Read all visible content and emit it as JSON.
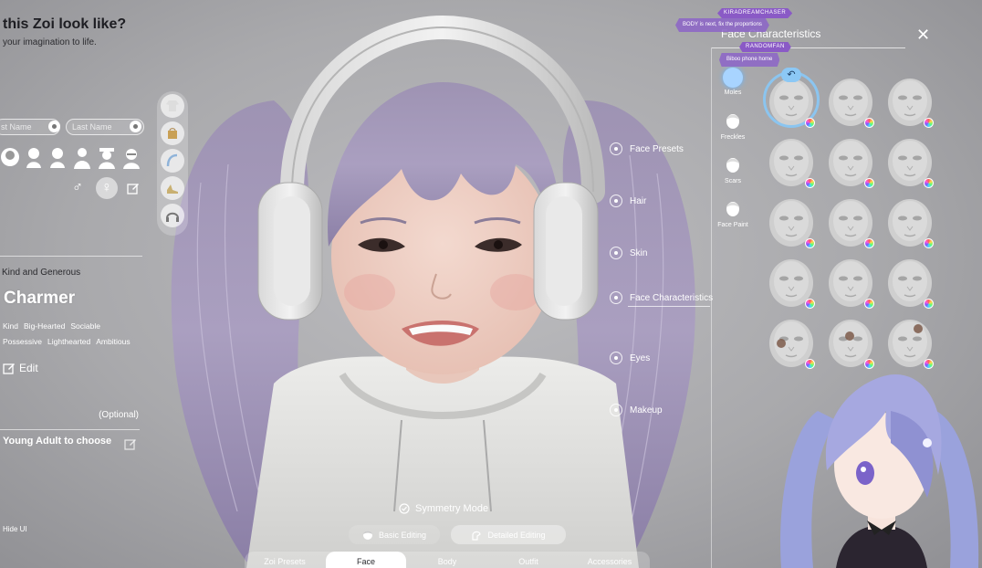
{
  "header": {
    "title": "this Zoi look like?",
    "subtitle": "your imagination to life."
  },
  "name": {
    "first_placeholder": "st Name",
    "last_placeholder": "Last Name"
  },
  "gender": {
    "male_symbol": "♂",
    "female_symbol": "♀",
    "selected": "female"
  },
  "trait": {
    "aspiration": "Kind and Generous",
    "title": "Charmer",
    "tags_row1": [
      "Kind",
      "Big-Hearted",
      "Sociable"
    ],
    "tags_row2": [
      "Possessive",
      "Lighthearted",
      "Ambitious"
    ],
    "edit_label": "Edit"
  },
  "age": {
    "optional_label": "(Optional)",
    "value": "Young Adult to choose"
  },
  "hide_ui_label": "Hide UI",
  "face_nav": [
    "Face Presets",
    "Hair",
    "Skin",
    "Face Characteristics",
    "Eyes",
    "Makeup"
  ],
  "panel": {
    "title": "Face Characteristics",
    "close_symbol": "✕",
    "undo_symbol": "↶",
    "categories": [
      "Moles",
      "Freckles",
      "Scars",
      "Face Paint"
    ],
    "selected_category": "Moles",
    "selected_index": 0
  },
  "chat": {
    "user1": "KIRADREAMCHASER",
    "msg1": "BODY is next, fix the proportions",
    "user2": "RANDOMFAN",
    "msg2": "Biboo phone home"
  },
  "editing": {
    "symmetry_label": "Symmetry Mode",
    "basic_label": "Basic Editing",
    "detailed_label": "Detailed Editing"
  },
  "bottom_tabs": [
    "Zoi Presets",
    "Face",
    "Body",
    "Outfit",
    "Accessories"
  ],
  "active_tab": "Face",
  "colors": {
    "accent_blue": "#8bc5f0",
    "chat_purple": "#8a5ac6",
    "hair_lavender": "#a79ac2"
  }
}
